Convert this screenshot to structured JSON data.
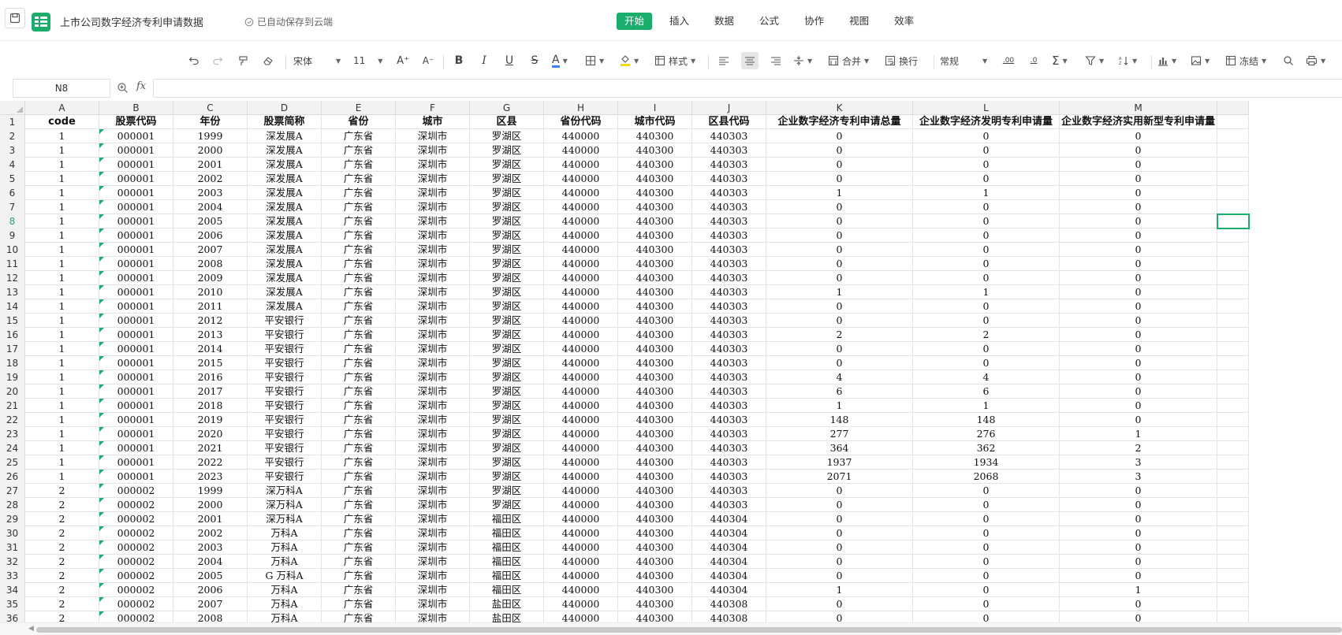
{
  "header": {
    "doc_title": "上市公司数字经济专利申请数据",
    "autosave": "已自动保存到云端",
    "menu": [
      {
        "label": "开始",
        "active": true
      },
      {
        "label": "插入",
        "active": false
      },
      {
        "label": "数据",
        "active": false
      },
      {
        "label": "公式",
        "active": false
      },
      {
        "label": "协作",
        "active": false
      },
      {
        "label": "视图",
        "active": false
      },
      {
        "label": "效率",
        "active": false
      }
    ]
  },
  "toolbar": {
    "font_name": "宋体",
    "font_size": "11",
    "style_label": "样式",
    "merge_label": "合并",
    "wrap_label": "换行",
    "number_format": "常规",
    "freeze_label": "冻结",
    "font_color": "#3b82f6",
    "fill_color": "#f5d90a"
  },
  "formula_bar": {
    "cell_ref": "N8",
    "fx": "fx",
    "value": ""
  },
  "sheet": {
    "columns": [
      "A",
      "B",
      "C",
      "D",
      "E",
      "F",
      "G",
      "H",
      "I",
      "J",
      "K",
      "L",
      "M"
    ],
    "header_row": [
      "code",
      "股票代码",
      "年份",
      "股票简称",
      "省份",
      "城市",
      "区县",
      "省份代码",
      "城市代码",
      "区县代码",
      "企业数字经济专利申请总量",
      "企业数字经济发明专利申请量",
      "企业数字经济实用新型专利申请量"
    ],
    "rows": [
      [
        "1",
        "000001",
        "1999",
        "深发展A",
        "广东省",
        "深圳市",
        "罗湖区",
        "440000",
        "440300",
        "440303",
        "0",
        "0",
        "0"
      ],
      [
        "1",
        "000001",
        "2000",
        "深发展A",
        "广东省",
        "深圳市",
        "罗湖区",
        "440000",
        "440300",
        "440303",
        "0",
        "0",
        "0"
      ],
      [
        "1",
        "000001",
        "2001",
        "深发展A",
        "广东省",
        "深圳市",
        "罗湖区",
        "440000",
        "440300",
        "440303",
        "0",
        "0",
        "0"
      ],
      [
        "1",
        "000001",
        "2002",
        "深发展A",
        "广东省",
        "深圳市",
        "罗湖区",
        "440000",
        "440300",
        "440303",
        "0",
        "0",
        "0"
      ],
      [
        "1",
        "000001",
        "2003",
        "深发展A",
        "广东省",
        "深圳市",
        "罗湖区",
        "440000",
        "440300",
        "440303",
        "1",
        "1",
        "0"
      ],
      [
        "1",
        "000001",
        "2004",
        "深发展A",
        "广东省",
        "深圳市",
        "罗湖区",
        "440000",
        "440300",
        "440303",
        "0",
        "0",
        "0"
      ],
      [
        "1",
        "000001",
        "2005",
        "深发展A",
        "广东省",
        "深圳市",
        "罗湖区",
        "440000",
        "440300",
        "440303",
        "0",
        "0",
        "0"
      ],
      [
        "1",
        "000001",
        "2006",
        "深发展A",
        "广东省",
        "深圳市",
        "罗湖区",
        "440000",
        "440300",
        "440303",
        "0",
        "0",
        "0"
      ],
      [
        "1",
        "000001",
        "2007",
        "深发展A",
        "广东省",
        "深圳市",
        "罗湖区",
        "440000",
        "440300",
        "440303",
        "0",
        "0",
        "0"
      ],
      [
        "1",
        "000001",
        "2008",
        "深发展A",
        "广东省",
        "深圳市",
        "罗湖区",
        "440000",
        "440300",
        "440303",
        "0",
        "0",
        "0"
      ],
      [
        "1",
        "000001",
        "2009",
        "深发展A",
        "广东省",
        "深圳市",
        "罗湖区",
        "440000",
        "440300",
        "440303",
        "0",
        "0",
        "0"
      ],
      [
        "1",
        "000001",
        "2010",
        "深发展A",
        "广东省",
        "深圳市",
        "罗湖区",
        "440000",
        "440300",
        "440303",
        "1",
        "1",
        "0"
      ],
      [
        "1",
        "000001",
        "2011",
        "深发展A",
        "广东省",
        "深圳市",
        "罗湖区",
        "440000",
        "440300",
        "440303",
        "0",
        "0",
        "0"
      ],
      [
        "1",
        "000001",
        "2012",
        "平安银行",
        "广东省",
        "深圳市",
        "罗湖区",
        "440000",
        "440300",
        "440303",
        "0",
        "0",
        "0"
      ],
      [
        "1",
        "000001",
        "2013",
        "平安银行",
        "广东省",
        "深圳市",
        "罗湖区",
        "440000",
        "440300",
        "440303",
        "2",
        "2",
        "0"
      ],
      [
        "1",
        "000001",
        "2014",
        "平安银行",
        "广东省",
        "深圳市",
        "罗湖区",
        "440000",
        "440300",
        "440303",
        "0",
        "0",
        "0"
      ],
      [
        "1",
        "000001",
        "2015",
        "平安银行",
        "广东省",
        "深圳市",
        "罗湖区",
        "440000",
        "440300",
        "440303",
        "0",
        "0",
        "0"
      ],
      [
        "1",
        "000001",
        "2016",
        "平安银行",
        "广东省",
        "深圳市",
        "罗湖区",
        "440000",
        "440300",
        "440303",
        "4",
        "4",
        "0"
      ],
      [
        "1",
        "000001",
        "2017",
        "平安银行",
        "广东省",
        "深圳市",
        "罗湖区",
        "440000",
        "440300",
        "440303",
        "6",
        "6",
        "0"
      ],
      [
        "1",
        "000001",
        "2018",
        "平安银行",
        "广东省",
        "深圳市",
        "罗湖区",
        "440000",
        "440300",
        "440303",
        "1",
        "1",
        "0"
      ],
      [
        "1",
        "000001",
        "2019",
        "平安银行",
        "广东省",
        "深圳市",
        "罗湖区",
        "440000",
        "440300",
        "440303",
        "148",
        "148",
        "0"
      ],
      [
        "1",
        "000001",
        "2020",
        "平安银行",
        "广东省",
        "深圳市",
        "罗湖区",
        "440000",
        "440300",
        "440303",
        "277",
        "276",
        "1"
      ],
      [
        "1",
        "000001",
        "2021",
        "平安银行",
        "广东省",
        "深圳市",
        "罗湖区",
        "440000",
        "440300",
        "440303",
        "364",
        "362",
        "2"
      ],
      [
        "1",
        "000001",
        "2022",
        "平安银行",
        "广东省",
        "深圳市",
        "罗湖区",
        "440000",
        "440300",
        "440303",
        "1937",
        "1934",
        "3"
      ],
      [
        "1",
        "000001",
        "2023",
        "平安银行",
        "广东省",
        "深圳市",
        "罗湖区",
        "440000",
        "440300",
        "440303",
        "2071",
        "2068",
        "3"
      ],
      [
        "2",
        "000002",
        "1999",
        "深万科A",
        "广东省",
        "深圳市",
        "罗湖区",
        "440000",
        "440300",
        "440303",
        "0",
        "0",
        "0"
      ],
      [
        "2",
        "000002",
        "2000",
        "深万科A",
        "广东省",
        "深圳市",
        "罗湖区",
        "440000",
        "440300",
        "440303",
        "0",
        "0",
        "0"
      ],
      [
        "2",
        "000002",
        "2001",
        "深万科A",
        "广东省",
        "深圳市",
        "福田区",
        "440000",
        "440300",
        "440304",
        "0",
        "0",
        "0"
      ],
      [
        "2",
        "000002",
        "2002",
        "万科A",
        "广东省",
        "深圳市",
        "福田区",
        "440000",
        "440300",
        "440304",
        "0",
        "0",
        "0"
      ],
      [
        "2",
        "000002",
        "2003",
        "万科A",
        "广东省",
        "深圳市",
        "福田区",
        "440000",
        "440300",
        "440304",
        "0",
        "0",
        "0"
      ],
      [
        "2",
        "000002",
        "2004",
        "万科A",
        "广东省",
        "深圳市",
        "福田区",
        "440000",
        "440300",
        "440304",
        "0",
        "0",
        "0"
      ],
      [
        "2",
        "000002",
        "2005",
        "G 万科A",
        "广东省",
        "深圳市",
        "福田区",
        "440000",
        "440300",
        "440304",
        "0",
        "0",
        "0"
      ],
      [
        "2",
        "000002",
        "2006",
        "万科A",
        "广东省",
        "深圳市",
        "福田区",
        "440000",
        "440300",
        "440304",
        "1",
        "0",
        "1"
      ],
      [
        "2",
        "000002",
        "2007",
        "万科A",
        "广东省",
        "深圳市",
        "盐田区",
        "440000",
        "440300",
        "440308",
        "0",
        "0",
        "0"
      ],
      [
        "2",
        "000002",
        "2008",
        "万科A",
        "广东省",
        "深圳市",
        "盐田区",
        "440000",
        "440300",
        "440308",
        "0",
        "0",
        "0"
      ]
    ],
    "selected_row": 8,
    "accent": "#1aad6b"
  }
}
